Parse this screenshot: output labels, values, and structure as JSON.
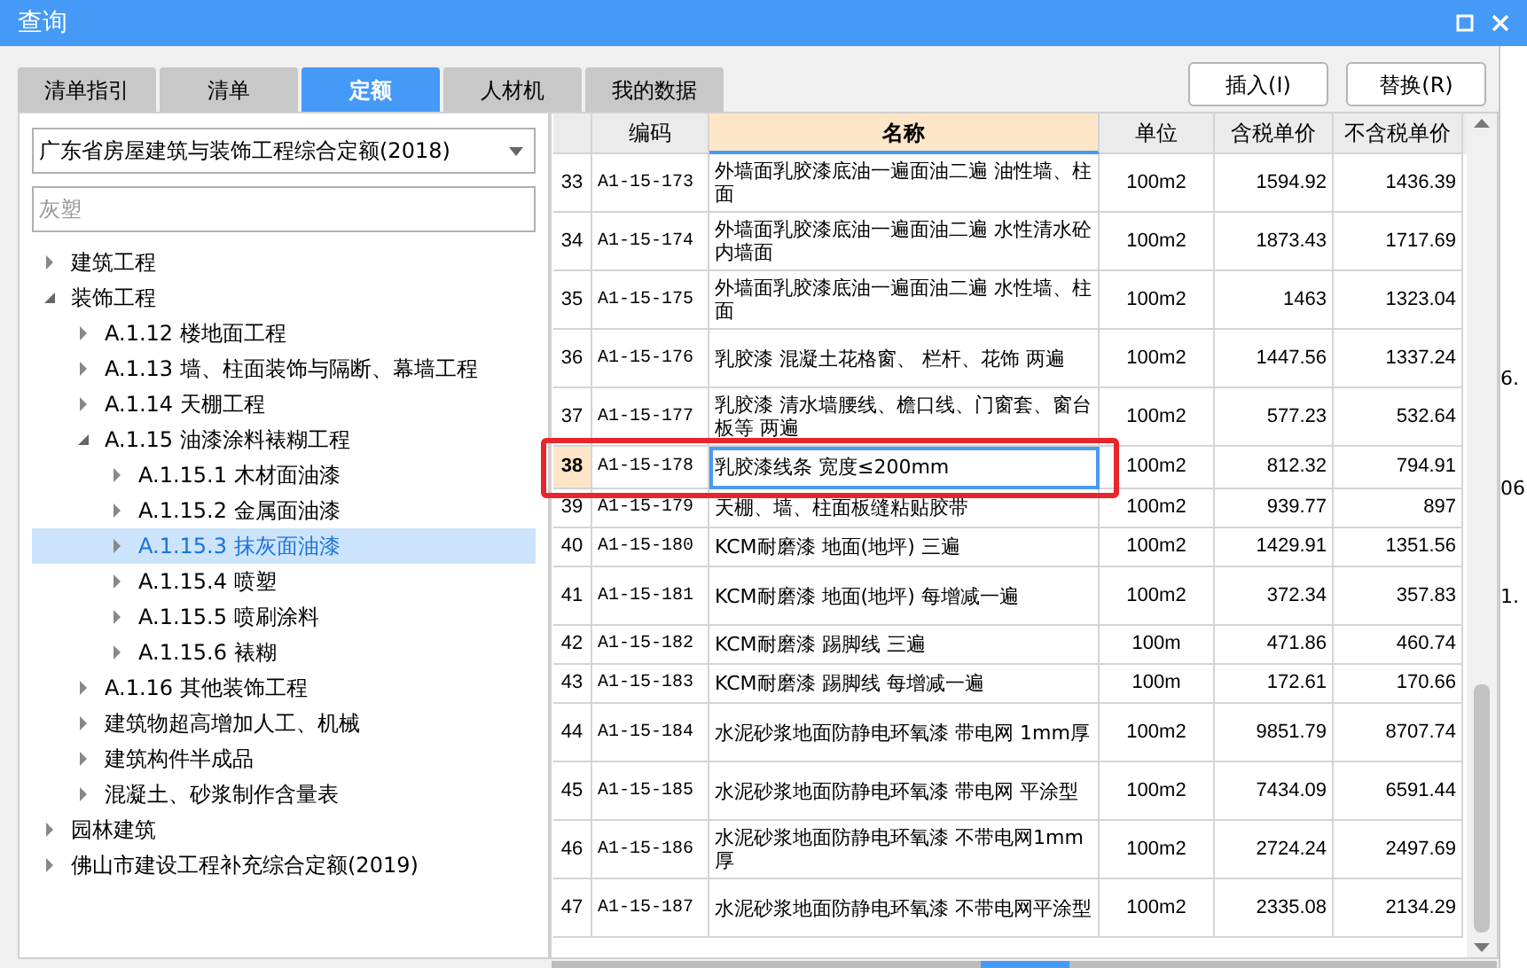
{
  "window": {
    "title": "查询"
  },
  "tabs": [
    {
      "label": "清单指引",
      "selected": false
    },
    {
      "label": "清单",
      "selected": false
    },
    {
      "label": "定额",
      "selected": true
    },
    {
      "label": "人材机",
      "selected": false
    },
    {
      "label": "我的数据",
      "selected": false
    }
  ],
  "buttons": [
    "插入(I)",
    "替换(R)"
  ],
  "library_select": {
    "value": "广东省房屋建筑与装饰工程综合定额(2018)"
  },
  "search": {
    "placeholder": "灰塑"
  },
  "tree": [
    {
      "label": "建筑工程",
      "expanded": false,
      "selected": false
    },
    {
      "label": "装饰工程",
      "expanded": true,
      "selected": false,
      "children": [
        {
          "label": "A.1.12 楼地面工程",
          "expanded": false,
          "selected": false
        },
        {
          "label": "A.1.13 墙、柱面装饰与隔断、幕墙工程",
          "expanded": false,
          "selected": false
        },
        {
          "label": "A.1.14 天棚工程",
          "expanded": false,
          "selected": false
        },
        {
          "label": "A.1.15 油漆涂料裱糊工程",
          "expanded": true,
          "selected": false,
          "children": [
            {
              "label": "A.1.15.1 木材面油漆",
              "expanded": false,
              "selected": false
            },
            {
              "label": "A.1.15.2 金属面油漆",
              "expanded": false,
              "selected": false
            },
            {
              "label": "A.1.15.3 抹灰面油漆",
              "expanded": false,
              "selected": true
            },
            {
              "label": "A.1.15.4 喷塑",
              "expanded": false,
              "selected": false
            },
            {
              "label": "A.1.15.5 喷刷涂料",
              "expanded": false,
              "selected": false
            },
            {
              "label": "A.1.15.6 裱糊",
              "expanded": false,
              "selected": false
            }
          ]
        },
        {
          "label": "A.1.16 其他装饰工程",
          "expanded": false,
          "selected": false
        },
        {
          "label": "建筑物超高增加人工、机械",
          "expanded": false,
          "selected": false
        },
        {
          "label": "建筑构件半成品",
          "expanded": false,
          "selected": false
        },
        {
          "label": "混凝土、砂浆制作含量表",
          "expanded": false,
          "selected": false
        }
      ]
    },
    {
      "label": "园林建筑",
      "expanded": false,
      "selected": false
    },
    {
      "label": "佛山市建设工程补充综合定额(2019)",
      "expanded": false,
      "selected": false
    }
  ],
  "table": {
    "columns": [
      "编码",
      "名称",
      "单位",
      "含税单价",
      "不含税单价"
    ],
    "rows": [
      {
        "no": "33",
        "code": "A1-15-173",
        "name": "外墙面乳胶漆底油一遍面油二遍 油性墙、柱面",
        "unit": "100m2",
        "tax": "1594.92",
        "notax": "1436.39",
        "selected": false
      },
      {
        "no": "34",
        "code": "A1-15-174",
        "name": "外墙面乳胶漆底油一遍面油二遍 水性清水砼内墙面",
        "unit": "100m2",
        "tax": "1873.43",
        "notax": "1717.69",
        "selected": false
      },
      {
        "no": "35",
        "code": "A1-15-175",
        "name": "外墙面乳胶漆底油一遍面油二遍 水性墙、柱面",
        "unit": "100m2",
        "tax": "1463",
        "notax": "1323.04",
        "selected": false
      },
      {
        "no": "36",
        "code": "A1-15-176",
        "name": "乳胶漆 混凝土花格窗、 栏杆、花饰 两遍",
        "unit": "100m2",
        "tax": "1447.56",
        "notax": "1337.24",
        "selected": false
      },
      {
        "no": "37",
        "code": "A1-15-177",
        "name": "乳胶漆 清水墙腰线、檐口线、门窗套、窗台板等 两遍",
        "unit": "100m2",
        "tax": "577.23",
        "notax": "532.64",
        "selected": false
      },
      {
        "no": "38",
        "code": "A1-15-178",
        "name": "乳胶漆线条 宽度≤200mm",
        "unit": "100m2",
        "tax": "812.32",
        "notax": "794.91",
        "selected": true
      },
      {
        "no": "39",
        "code": "A1-15-179",
        "name": "天棚、墙、柱面板缝粘贴胶带",
        "unit": "100m2",
        "tax": "939.77",
        "notax": "897",
        "selected": false
      },
      {
        "no": "40",
        "code": "A1-15-180",
        "name": "KCM耐磨漆 地面(地坪) 三遍",
        "unit": "100m2",
        "tax": "1429.91",
        "notax": "1351.56",
        "selected": false
      },
      {
        "no": "41",
        "code": "A1-15-181",
        "name": "KCM耐磨漆 地面(地坪) 每增减一遍",
        "unit": "100m2",
        "tax": "372.34",
        "notax": "357.83",
        "selected": false
      },
      {
        "no": "42",
        "code": "A1-15-182",
        "name": "KCM耐磨漆 踢脚线 三遍",
        "unit": "100m",
        "tax": "471.86",
        "notax": "460.74",
        "selected": false
      },
      {
        "no": "43",
        "code": "A1-15-183",
        "name": "KCM耐磨漆 踢脚线 每增减一遍",
        "unit": "100m",
        "tax": "172.61",
        "notax": "170.66",
        "selected": false
      },
      {
        "no": "44",
        "code": "A1-15-184",
        "name": "水泥砂浆地面防静电环氧漆 带电网 1mm厚",
        "unit": "100m2",
        "tax": "9851.79",
        "notax": "8707.74",
        "selected": false
      },
      {
        "no": "45",
        "code": "A1-15-185",
        "name": "水泥砂浆地面防静电环氧漆 带电网 平涂型",
        "unit": "100m2",
        "tax": "7434.09",
        "notax": "6591.44",
        "selected": false
      },
      {
        "no": "46",
        "code": "A1-15-186",
        "name": "水泥砂浆地面防静电环氧漆 不带电网1mm厚",
        "unit": "100m2",
        "tax": "2724.24",
        "notax": "2497.69",
        "selected": false
      },
      {
        "no": "47",
        "code": "A1-15-187",
        "name": "水泥砂浆地面防静电环氧漆 不带电网平涂型",
        "unit": "100m2",
        "tax": "2335.08",
        "notax": "2134.29",
        "selected": false
      }
    ]
  },
  "background_fragments": [
    "6.",
    "06",
    "1."
  ]
}
